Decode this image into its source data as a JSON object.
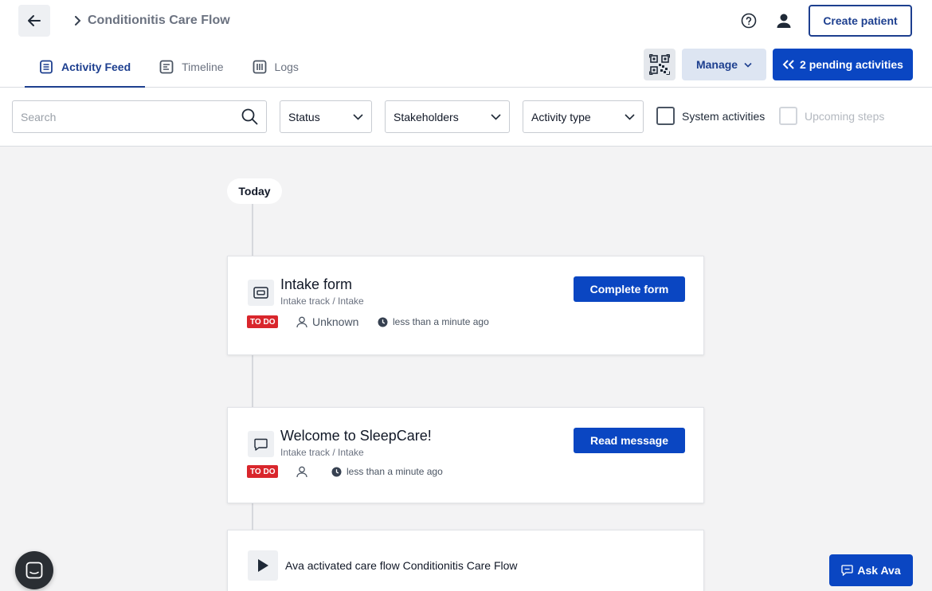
{
  "header": {
    "breadcrumb": "Conditionitis Care Flow",
    "create_patient_label": "Create patient"
  },
  "tabs": [
    {
      "label": "Activity Feed",
      "active": true,
      "icon": "document-icon"
    },
    {
      "label": "Timeline",
      "active": false,
      "icon": "timeline-icon"
    },
    {
      "label": "Logs",
      "active": false,
      "icon": "logs-icon"
    }
  ],
  "toolbar": {
    "manage_label": "Manage",
    "pending_label": "2 pending activities"
  },
  "filters": {
    "search_placeholder": "Search",
    "status_label": "Status",
    "stakeholders_label": "Stakeholders",
    "activity_type_label": "Activity type",
    "system_activities_label": "System activities",
    "upcoming_steps_label": "Upcoming steps"
  },
  "feed": {
    "date_label": "Today",
    "cards": [
      {
        "title": "Intake form",
        "subtitle": "Intake track / Intake",
        "status": "TO DO",
        "stakeholder": "Unknown",
        "time": "less than a minute ago",
        "action_label": "Complete form",
        "icon": "form-icon"
      },
      {
        "title": "Welcome to SleepCare!",
        "subtitle": "Intake track / Intake",
        "status": "TO DO",
        "stakeholder": "",
        "time": "less than a minute ago",
        "action_label": "Read message",
        "icon": "message-icon"
      },
      {
        "title": "Ava activated care flow Conditionitis Care Flow",
        "icon": "play-icon"
      }
    ]
  },
  "widgets": {
    "ask_ava_label": "Ask Ava"
  },
  "colors": {
    "primary": "#0a46c2",
    "brand_dark": "#1d3f8f",
    "todo_badge": "#d9262c",
    "background": "#f3f3f4"
  }
}
